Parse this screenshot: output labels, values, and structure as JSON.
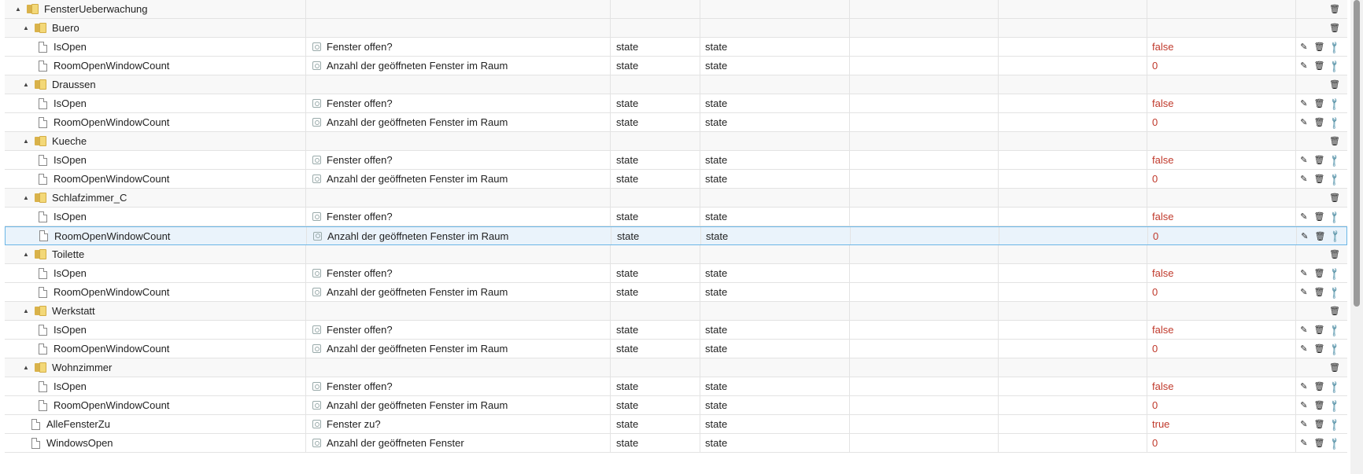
{
  "rows": [
    {
      "kind": "folder",
      "level": 0,
      "name": "FensterUeberwachung"
    },
    {
      "kind": "folder",
      "level": 1,
      "name": "Buero"
    },
    {
      "kind": "state",
      "level": 2,
      "name": "IsOpen",
      "desc": "Fenster offen?",
      "type": "state",
      "role": "state",
      "value": "false"
    },
    {
      "kind": "state",
      "level": 2,
      "name": "RoomOpenWindowCount",
      "desc": "Anzahl der geöffneten Fenster im Raum",
      "type": "state",
      "role": "state",
      "value": "0"
    },
    {
      "kind": "folder",
      "level": 1,
      "name": "Draussen"
    },
    {
      "kind": "state",
      "level": 2,
      "name": "IsOpen",
      "desc": "Fenster offen?",
      "type": "state",
      "role": "state",
      "value": "false"
    },
    {
      "kind": "state",
      "level": 2,
      "name": "RoomOpenWindowCount",
      "desc": "Anzahl der geöffneten Fenster im Raum",
      "type": "state",
      "role": "state",
      "value": "0"
    },
    {
      "kind": "folder",
      "level": 1,
      "name": "Kueche"
    },
    {
      "kind": "state",
      "level": 2,
      "name": "IsOpen",
      "desc": "Fenster offen?",
      "type": "state",
      "role": "state",
      "value": "false"
    },
    {
      "kind": "state",
      "level": 2,
      "name": "RoomOpenWindowCount",
      "desc": "Anzahl der geöffneten Fenster im Raum",
      "type": "state",
      "role": "state",
      "value": "0"
    },
    {
      "kind": "folder",
      "level": 1,
      "name": "Schlafzimmer_C"
    },
    {
      "kind": "state",
      "level": 2,
      "name": "IsOpen",
      "desc": "Fenster offen?",
      "type": "state",
      "role": "state",
      "value": "false"
    },
    {
      "kind": "state",
      "level": 2,
      "name": "RoomOpenWindowCount",
      "desc": "Anzahl der geöffneten Fenster im Raum",
      "type": "state",
      "role": "state",
      "value": "0",
      "selected": true
    },
    {
      "kind": "folder",
      "level": 1,
      "name": "Toilette"
    },
    {
      "kind": "state",
      "level": 2,
      "name": "IsOpen",
      "desc": "Fenster offen?",
      "type": "state",
      "role": "state",
      "value": "false"
    },
    {
      "kind": "state",
      "level": 2,
      "name": "RoomOpenWindowCount",
      "desc": "Anzahl der geöffneten Fenster im Raum",
      "type": "state",
      "role": "state",
      "value": "0"
    },
    {
      "kind": "folder",
      "level": 1,
      "name": "Werkstatt"
    },
    {
      "kind": "state",
      "level": 2,
      "name": "IsOpen",
      "desc": "Fenster offen?",
      "type": "state",
      "role": "state",
      "value": "false"
    },
    {
      "kind": "state",
      "level": 2,
      "name": "RoomOpenWindowCount",
      "desc": "Anzahl der geöffneten Fenster im Raum",
      "type": "state",
      "role": "state",
      "value": "0"
    },
    {
      "kind": "folder",
      "level": 1,
      "name": "Wohnzimmer"
    },
    {
      "kind": "state",
      "level": 2,
      "name": "IsOpen",
      "desc": "Fenster offen?",
      "type": "state",
      "role": "state",
      "value": "false"
    },
    {
      "kind": "state",
      "level": 2,
      "name": "RoomOpenWindowCount",
      "desc": "Anzahl der geöffneten Fenster im Raum",
      "type": "state",
      "role": "state",
      "value": "0"
    },
    {
      "kind": "state",
      "level": 1,
      "name": "AlleFensterZu",
      "desc": "Fenster zu?",
      "type": "state",
      "role": "state",
      "value": "true"
    },
    {
      "kind": "state",
      "level": 1,
      "name": "WindowsOpen",
      "desc": "Anzahl der geöffneten Fenster",
      "type": "state",
      "role": "state",
      "value": "0"
    }
  ],
  "icons": {
    "toggle": "▲",
    "edit": "✎",
    "delete": "🗑",
    "settings": "🔧"
  },
  "colors": {
    "value_text": "#c0392b",
    "selected_row_bg": "#eaf3fb",
    "selected_row_border": "#6bb6e6"
  }
}
